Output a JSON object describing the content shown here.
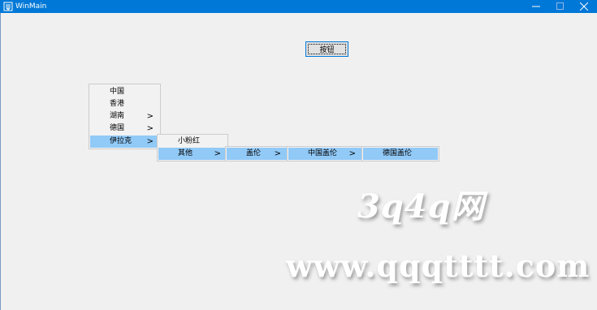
{
  "window": {
    "title": "WinMain",
    "icon": "app-logo-icon"
  },
  "controls": {
    "minimize_icon": "minimize-icon",
    "maximize_icon": "maximize-icon",
    "close_icon": "close-icon"
  },
  "main": {
    "button_label": "按钮"
  },
  "menus": {
    "level1": [
      {
        "label": "中国",
        "has_submenu": false
      },
      {
        "label": "香港",
        "has_submenu": false
      },
      {
        "label": "湖南",
        "has_submenu": true
      },
      {
        "label": "德国",
        "has_submenu": true
      },
      {
        "label": "伊拉克",
        "has_submenu": true,
        "highlighted": true
      }
    ],
    "level2": [
      {
        "label": "小粉红",
        "has_submenu": false
      },
      {
        "label": "其他",
        "has_submenu": true,
        "highlighted": true
      }
    ],
    "level3": [
      {
        "label": "盖伦",
        "has_submenu": true,
        "highlighted": true
      }
    ],
    "level4": [
      {
        "label": "中国盖伦",
        "has_submenu": true,
        "highlighted": true
      }
    ],
    "level5": [
      {
        "label": "德国盖伦",
        "has_submenu": false,
        "highlighted": true
      }
    ],
    "arrow": ">"
  },
  "watermark": {
    "line1": "3q4q网",
    "line2": "www.qqqtttt.com"
  }
}
